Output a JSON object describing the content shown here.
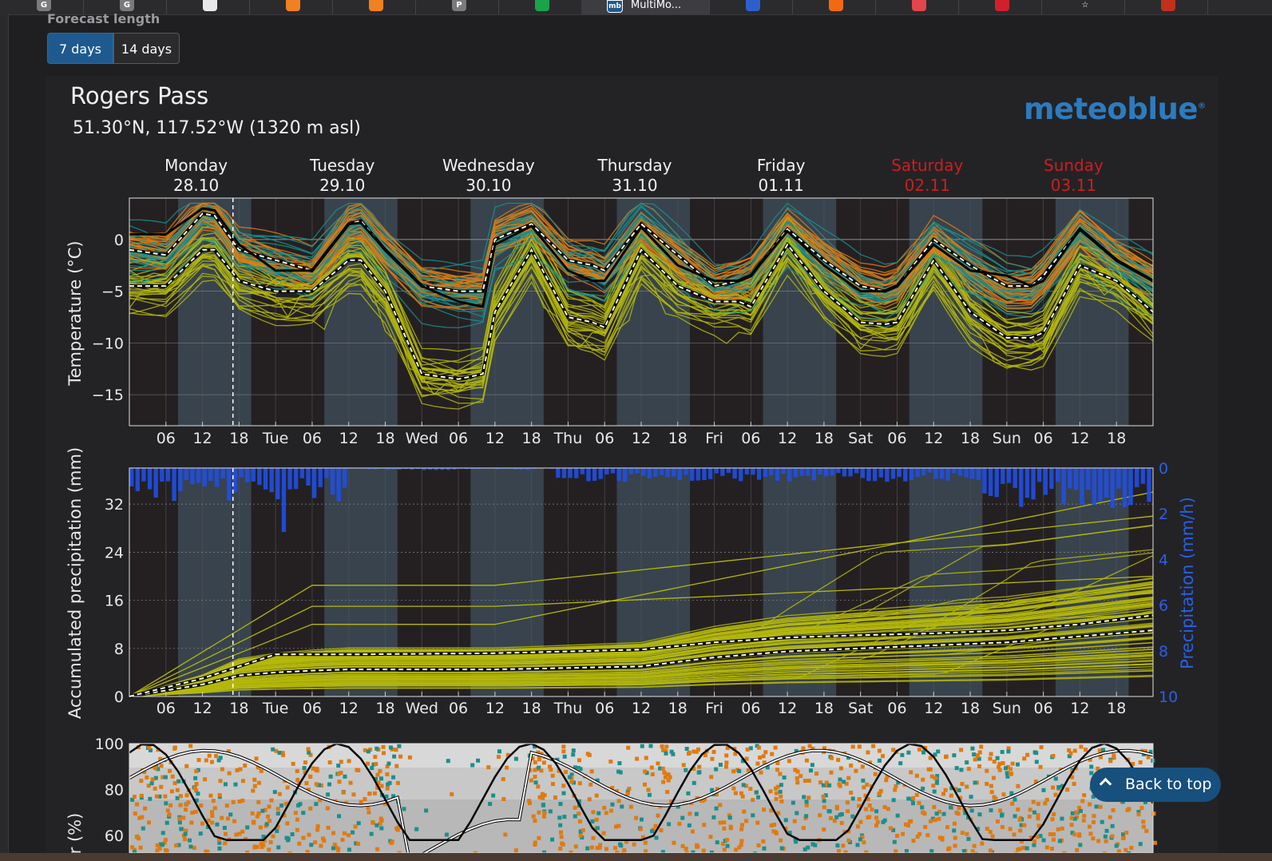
{
  "browser": {
    "active_tab_title": "MultiMo...",
    "tab_icons": [
      "g-icon",
      "g-icon",
      "document-icon",
      "sunset-icon",
      "compass-icon",
      "p-icon",
      "layers-icon",
      "meteoblue-icon",
      "mountain-icon",
      "aw-icon",
      "airbnb-icon",
      "pinterest-icon",
      "star-icon",
      "fire-icon"
    ],
    "active_tab_badge": "mb"
  },
  "controls": {
    "forecast_length_label": "Forecast length",
    "options": [
      "7 days",
      "14 days"
    ],
    "selected": "7 days"
  },
  "location": {
    "name": "Rogers Pass",
    "coords": "51.30°N, 117.52°W (1320 m asl)",
    "logo_text": "meteoblue"
  },
  "days": [
    {
      "name": "Monday",
      "date": "28.10",
      "weekend": false
    },
    {
      "name": "Tuesday",
      "date": "29.10",
      "weekend": false
    },
    {
      "name": "Wednesday",
      "date": "30.10",
      "weekend": false
    },
    {
      "name": "Thursday",
      "date": "31.10",
      "weekend": false
    },
    {
      "name": "Friday",
      "date": "01.11",
      "weekend": false
    },
    {
      "name": "Saturday",
      "date": "02.11",
      "weekend": true
    },
    {
      "name": "Sunday",
      "date": "03.11",
      "weekend": true
    }
  ],
  "x_ticks": [
    "06",
    "12",
    "18",
    "Tue",
    "06",
    "12",
    "18",
    "Wed",
    "06",
    "12",
    "18",
    "Thu",
    "06",
    "12",
    "18",
    "Fri",
    "06",
    "12",
    "18",
    "Sat",
    "06",
    "12",
    "18",
    "Sun",
    "06",
    "12",
    "18"
  ],
  "colors": {
    "weekend": "#cc1e1e",
    "night": "#3a4650",
    "ensemble_orange": "#e07a10",
    "ensemble_yellow": "#b5b80a",
    "ensemble_teal": "#1a8f8c",
    "precip_bar": "#1f4fe8",
    "accent": "#1e5a8f"
  },
  "back_to_top": "Back to top",
  "chart_data": [
    {
      "type": "line",
      "ylabel": "Temperature (°C)",
      "ylim": [
        -18,
        4
      ],
      "yticks": [
        "0",
        "−5",
        "−10",
        "−15"
      ],
      "x_unit": "hours since Monday 00:00",
      "series": [
        {
          "role": "median",
          "x": [
            0,
            6,
            12,
            14,
            18,
            24,
            30,
            36,
            38,
            42,
            48,
            54,
            58,
            60,
            66,
            72,
            76,
            78,
            84,
            90,
            96,
            100,
            102,
            108,
            114,
            120,
            124,
            126,
            132,
            138,
            144,
            148,
            150,
            156,
            162,
            168
          ],
          "values": [
            -1,
            -1.5,
            2.5,
            2.3,
            -1,
            -2,
            -3,
            1.5,
            1.8,
            -1,
            -4.5,
            -5,
            -5,
            0,
            1.5,
            -2,
            -2.5,
            -3,
            1.5,
            -1.5,
            -4.5,
            -4,
            -3.5,
            1,
            -2,
            -4.5,
            -5,
            -4.5,
            0,
            -2.5,
            -4.5,
            -4.5,
            -3.5,
            1,
            -2,
            -4
          ]
        },
        {
          "role": "min-percentile",
          "x": [
            0,
            6,
            12,
            14,
            18,
            24,
            30,
            36,
            38,
            42,
            48,
            54,
            58,
            60,
            66,
            72,
            76,
            78,
            84,
            90,
            96,
            100,
            102,
            108,
            114,
            120,
            124,
            126,
            132,
            138,
            144,
            148,
            150,
            156,
            162,
            168
          ],
          "values": [
            -4.5,
            -4.5,
            -1,
            -1,
            -4,
            -5,
            -5,
            -2,
            -2,
            -5,
            -13,
            -13.5,
            -13,
            -7,
            -1,
            -7.5,
            -8,
            -8.5,
            -1,
            -4.5,
            -6,
            -6,
            -6.5,
            -0.5,
            -5,
            -8,
            -8.2,
            -8,
            -2,
            -7,
            -9.5,
            -9.5,
            -9,
            -2.5,
            -4,
            -7
          ]
        },
        {
          "role": "control",
          "x": [
            0,
            6,
            12,
            14,
            18,
            24,
            30,
            36,
            38,
            42,
            48,
            54,
            58,
            60,
            66,
            72,
            76,
            78,
            84,
            90,
            96,
            100,
            102,
            108,
            114,
            120,
            124,
            126,
            132,
            138,
            144,
            148,
            150,
            156,
            162,
            168
          ],
          "values": [
            0.5,
            0.5,
            3,
            2.8,
            -0.5,
            -3,
            -3,
            1.5,
            1.6,
            -1,
            -4.5,
            -6,
            -6.5,
            -0.5,
            1.3,
            -3,
            -4,
            -4,
            1.2,
            -2.5,
            -4,
            -4,
            -3.5,
            0.8,
            -2.5,
            -5,
            -5,
            -4.5,
            -0.5,
            -3,
            -3.5,
            -4.5,
            -4,
            1,
            -2,
            -4
          ]
        }
      ]
    },
    {
      "type": "line",
      "ylabel": "Accumulated precipitation (mm)",
      "ylabel_right": "Precipitation (mm/h)",
      "ylim": [
        0,
        38
      ],
      "yticks": [
        "32",
        "24",
        "16",
        "8",
        "0"
      ],
      "yticks_right": [
        "0",
        "2",
        "4",
        "6",
        "8",
        "10"
      ],
      "x_unit": "hours since Monday 00:00",
      "series": [
        {
          "role": "median",
          "x": [
            0,
            6,
            12,
            18,
            24,
            30,
            36,
            60,
            84,
            96,
            108,
            120,
            132,
            144,
            156,
            168
          ],
          "values": [
            0,
            1,
            2,
            3.5,
            4,
            4.3,
            4.5,
            4.5,
            5,
            6.5,
            7.5,
            8,
            8.5,
            9,
            10,
            11
          ]
        },
        {
          "role": "upper",
          "x": [
            0,
            6,
            12,
            18,
            24,
            30,
            36,
            60,
            84,
            96,
            108,
            120,
            132,
            144,
            156,
            168
          ],
          "values": [
            0,
            1.5,
            3,
            5,
            7,
            7,
            7,
            7.2,
            7.8,
            9,
            9.8,
            10.2,
            10.5,
            11,
            12,
            13.5
          ]
        }
      ]
    },
    {
      "type": "line",
      "ylabel": "er (%)",
      "ylim": [
        60,
        100
      ],
      "yticks": [
        "100",
        "80",
        "60"
      ]
    }
  ]
}
